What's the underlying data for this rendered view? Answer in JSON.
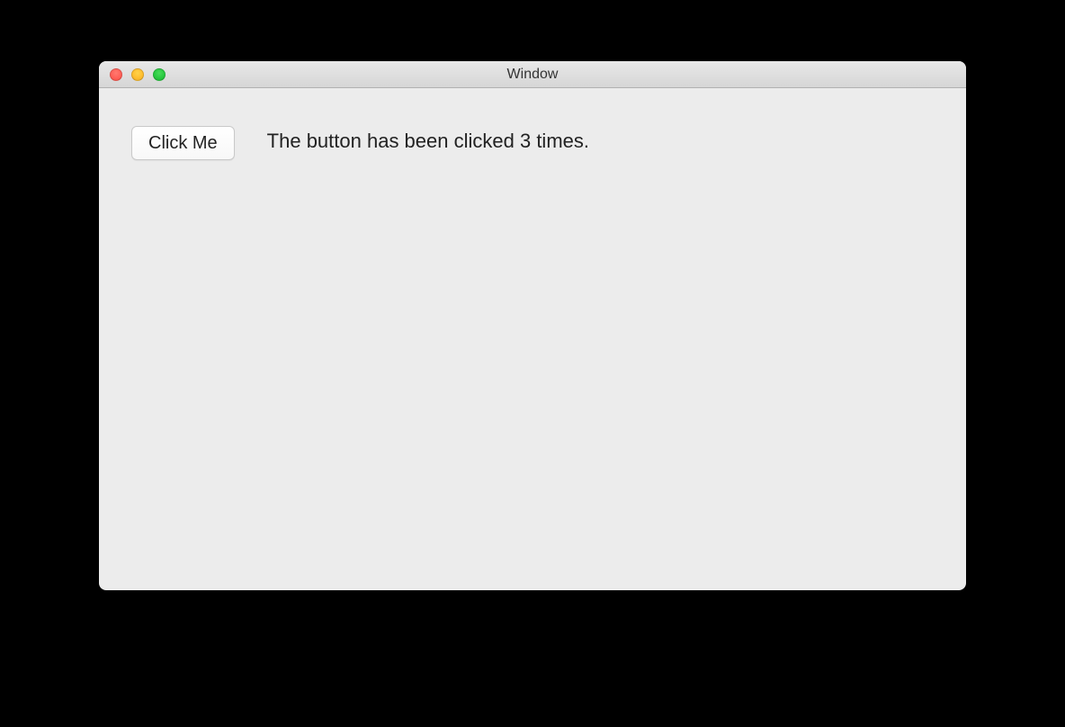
{
  "window": {
    "title": "Window"
  },
  "content": {
    "button_label": "Click Me",
    "status_text": "The button has been clicked 3 times."
  }
}
